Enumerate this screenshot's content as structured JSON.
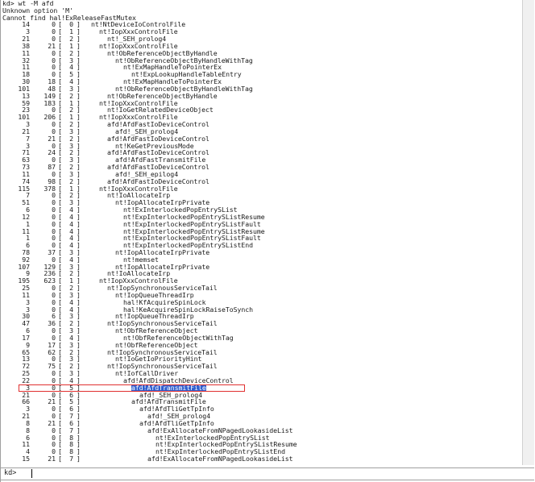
{
  "header_lines": [
    "kd> wt -M afd",
    "Unknown option 'M'",
    "Cannot find hal!ExReleaseFastMutex"
  ],
  "trace_rows": [
    {
      "a": "14",
      "b": "0",
      "c": "0",
      "depth": 0,
      "fn": "nt!NtDeviceIoControlFile"
    },
    {
      "a": "3",
      "b": "0",
      "c": "1",
      "depth": 1,
      "fn": "nt!IopXxxControlFile"
    },
    {
      "a": "21",
      "b": "0",
      "c": "2",
      "depth": 2,
      "fn": "nt!_SEH_prolog4"
    },
    {
      "a": "38",
      "b": "21",
      "c": "1",
      "depth": 1,
      "fn": "nt!IopXxxControlFile"
    },
    {
      "a": "11",
      "b": "0",
      "c": "2",
      "depth": 2,
      "fn": "nt!ObReferenceObjectByHandle"
    },
    {
      "a": "32",
      "b": "0",
      "c": "3",
      "depth": 3,
      "fn": "nt!ObReferenceObjectByHandleWithTag"
    },
    {
      "a": "11",
      "b": "0",
      "c": "4",
      "depth": 4,
      "fn": "nt!ExMapHandleToPointerEx"
    },
    {
      "a": "18",
      "b": "0",
      "c": "5",
      "depth": 5,
      "fn": "nt!ExpLookupHandleTableEntry"
    },
    {
      "a": "30",
      "b": "18",
      "c": "4",
      "depth": 4,
      "fn": "nt!ExMapHandleToPointerEx"
    },
    {
      "a": "101",
      "b": "48",
      "c": "3",
      "depth": 3,
      "fn": "nt!ObReferenceObjectByHandleWithTag"
    },
    {
      "a": "13",
      "b": "149",
      "c": "2",
      "depth": 2,
      "fn": "nt!ObReferenceObjectByHandle"
    },
    {
      "a": "59",
      "b": "183",
      "c": "1",
      "depth": 1,
      "fn": "nt!IopXxxControlFile"
    },
    {
      "a": "23",
      "b": "0",
      "c": "2",
      "depth": 2,
      "fn": "nt!IoGetRelatedDeviceObject"
    },
    {
      "a": "101",
      "b": "206",
      "c": "1",
      "depth": 1,
      "fn": "nt!IopXxxControlFile"
    },
    {
      "a": "3",
      "b": "0",
      "c": "2",
      "depth": 2,
      "fn": "afd!AfdFastIoDeviceControl"
    },
    {
      "a": "21",
      "b": "0",
      "c": "3",
      "depth": 3,
      "fn": "afd!_SEH_prolog4"
    },
    {
      "a": "7",
      "b": "21",
      "c": "2",
      "depth": 2,
      "fn": "afd!AfdFastIoDeviceControl"
    },
    {
      "a": "3",
      "b": "0",
      "c": "3",
      "depth": 3,
      "fn": "nt!KeGetPreviousMode"
    },
    {
      "a": "71",
      "b": "24",
      "c": "2",
      "depth": 2,
      "fn": "afd!AfdFastIoDeviceControl"
    },
    {
      "a": "63",
      "b": "0",
      "c": "3",
      "depth": 3,
      "fn": "afd!AfdFastTransmitFile"
    },
    {
      "a": "73",
      "b": "87",
      "c": "2",
      "depth": 2,
      "fn": "afd!AfdFastIoDeviceControl"
    },
    {
      "a": "11",
      "b": "0",
      "c": "3",
      "depth": 3,
      "fn": "afd!_SEH_epilog4"
    },
    {
      "a": "74",
      "b": "98",
      "c": "2",
      "depth": 2,
      "fn": "afd!AfdFastIoDeviceControl"
    },
    {
      "a": "115",
      "b": "378",
      "c": "1",
      "depth": 1,
      "fn": "nt!IopXxxControlFile"
    },
    {
      "a": "7",
      "b": "0",
      "c": "2",
      "depth": 2,
      "fn": "nt!IoAllocateIrp"
    },
    {
      "a": "51",
      "b": "0",
      "c": "3",
      "depth": 3,
      "fn": "nt!IopAllocateIrpPrivate"
    },
    {
      "a": "6",
      "b": "0",
      "c": "4",
      "depth": 4,
      "fn": "nt!ExInterlockedPopEntrySList"
    },
    {
      "a": "12",
      "b": "0",
      "c": "4",
      "depth": 4,
      "fn": "nt!ExpInterlockedPopEntrySListResume"
    },
    {
      "a": "1",
      "b": "0",
      "c": "4",
      "depth": 4,
      "fn": "nt!ExpInterlockedPopEntrySListFault"
    },
    {
      "a": "11",
      "b": "0",
      "c": "4",
      "depth": 4,
      "fn": "nt!ExpInterlockedPopEntrySListResume"
    },
    {
      "a": "1",
      "b": "0",
      "c": "4",
      "depth": 4,
      "fn": "nt!ExpInterlockedPopEntrySListFault"
    },
    {
      "a": "6",
      "b": "0",
      "c": "4",
      "depth": 4,
      "fn": "nt!ExpInterlockedPopEntrySListEnd"
    },
    {
      "a": "78",
      "b": "37",
      "c": "3",
      "depth": 3,
      "fn": "nt!IopAllocateIrpPrivate"
    },
    {
      "a": "92",
      "b": "0",
      "c": "4",
      "depth": 4,
      "fn": "nt!memset"
    },
    {
      "a": "107",
      "b": "129",
      "c": "3",
      "depth": 3,
      "fn": "nt!IopAllocateIrpPrivate"
    },
    {
      "a": "9",
      "b": "236",
      "c": "2",
      "depth": 2,
      "fn": "nt!IoAllocateIrp"
    },
    {
      "a": "195",
      "b": "623",
      "c": "1",
      "depth": 1,
      "fn": "nt!IopXxxControlFile"
    },
    {
      "a": "25",
      "b": "0",
      "c": "2",
      "depth": 2,
      "fn": "nt!IopSynchronousServiceTail"
    },
    {
      "a": "11",
      "b": "0",
      "c": "3",
      "depth": 3,
      "fn": "nt!IopQueueThreadIrp"
    },
    {
      "a": "3",
      "b": "0",
      "c": "4",
      "depth": 4,
      "fn": "hal!KfAcquireSpinLock"
    },
    {
      "a": "3",
      "b": "0",
      "c": "4",
      "depth": 4,
      "fn": "hal!KeAcquireSpinLockRaiseToSynch"
    },
    {
      "a": "30",
      "b": "6",
      "c": "3",
      "depth": 3,
      "fn": "nt!IopQueueThreadIrp"
    },
    {
      "a": "47",
      "b": "36",
      "c": "2",
      "depth": 2,
      "fn": "nt!IopSynchronousServiceTail"
    },
    {
      "a": "6",
      "b": "0",
      "c": "3",
      "depth": 3,
      "fn": "nt!ObfReferenceObject"
    },
    {
      "a": "17",
      "b": "0",
      "c": "4",
      "depth": 4,
      "fn": "nt!ObfReferenceObjectWithTag"
    },
    {
      "a": "9",
      "b": "17",
      "c": "3",
      "depth": 3,
      "fn": "nt!ObfReferenceObject"
    },
    {
      "a": "65",
      "b": "62",
      "c": "2",
      "depth": 2,
      "fn": "nt!IopSynchronousServiceTail"
    },
    {
      "a": "13",
      "b": "0",
      "c": "3",
      "depth": 3,
      "fn": "nt!IoGetIoPriorityHint"
    },
    {
      "a": "72",
      "b": "75",
      "c": "2",
      "depth": 2,
      "fn": "nt!IopSynchronousServiceTail"
    },
    {
      "a": "25",
      "b": "0",
      "c": "3",
      "depth": 3,
      "fn": "nt!IofCallDriver"
    },
    {
      "a": "22",
      "b": "0",
      "c": "4",
      "depth": 4,
      "fn": "afd!AfdDispatchDeviceControl"
    },
    {
      "a": "3",
      "b": "0",
      "c": "5",
      "depth": 5,
      "fn": "afd!AfdTransmitFile",
      "highlight": true
    },
    {
      "a": "21",
      "b": "0",
      "c": "6",
      "depth": 6,
      "fn": "afd!_SEH_prolog4"
    },
    {
      "a": "66",
      "b": "21",
      "c": "5",
      "depth": 5,
      "fn": "afd!AfdTransmitFile"
    },
    {
      "a": "3",
      "b": "0",
      "c": "6",
      "depth": 6,
      "fn": "afd!AfdTliGetTpInfo"
    },
    {
      "a": "21",
      "b": "0",
      "c": "7",
      "depth": 7,
      "fn": "afd!_SEH_prolog4"
    },
    {
      "a": "8",
      "b": "21",
      "c": "6",
      "depth": 6,
      "fn": "afd!AfdTliGetTpInfo"
    },
    {
      "a": "8",
      "b": "0",
      "c": "7",
      "depth": 7,
      "fn": "afd!ExAllocateFromNPagedLookasideList"
    },
    {
      "a": "6",
      "b": "0",
      "c": "8",
      "depth": 8,
      "fn": "nt!ExInterlockedPopEntrySList"
    },
    {
      "a": "11",
      "b": "0",
      "c": "8",
      "depth": 8,
      "fn": "nt!ExpInterlockedPopEntrySListResume"
    },
    {
      "a": "4",
      "b": "0",
      "c": "8",
      "depth": 8,
      "fn": "nt!ExpInterlockedPopEntrySListEnd"
    },
    {
      "a": "15",
      "b": "21",
      "c": "7",
      "depth": 7,
      "fn": "afd!ExAllocateFromNPagedLookasideList"
    }
  ],
  "command_bar": {
    "prompt": "kd>",
    "value": ""
  }
}
